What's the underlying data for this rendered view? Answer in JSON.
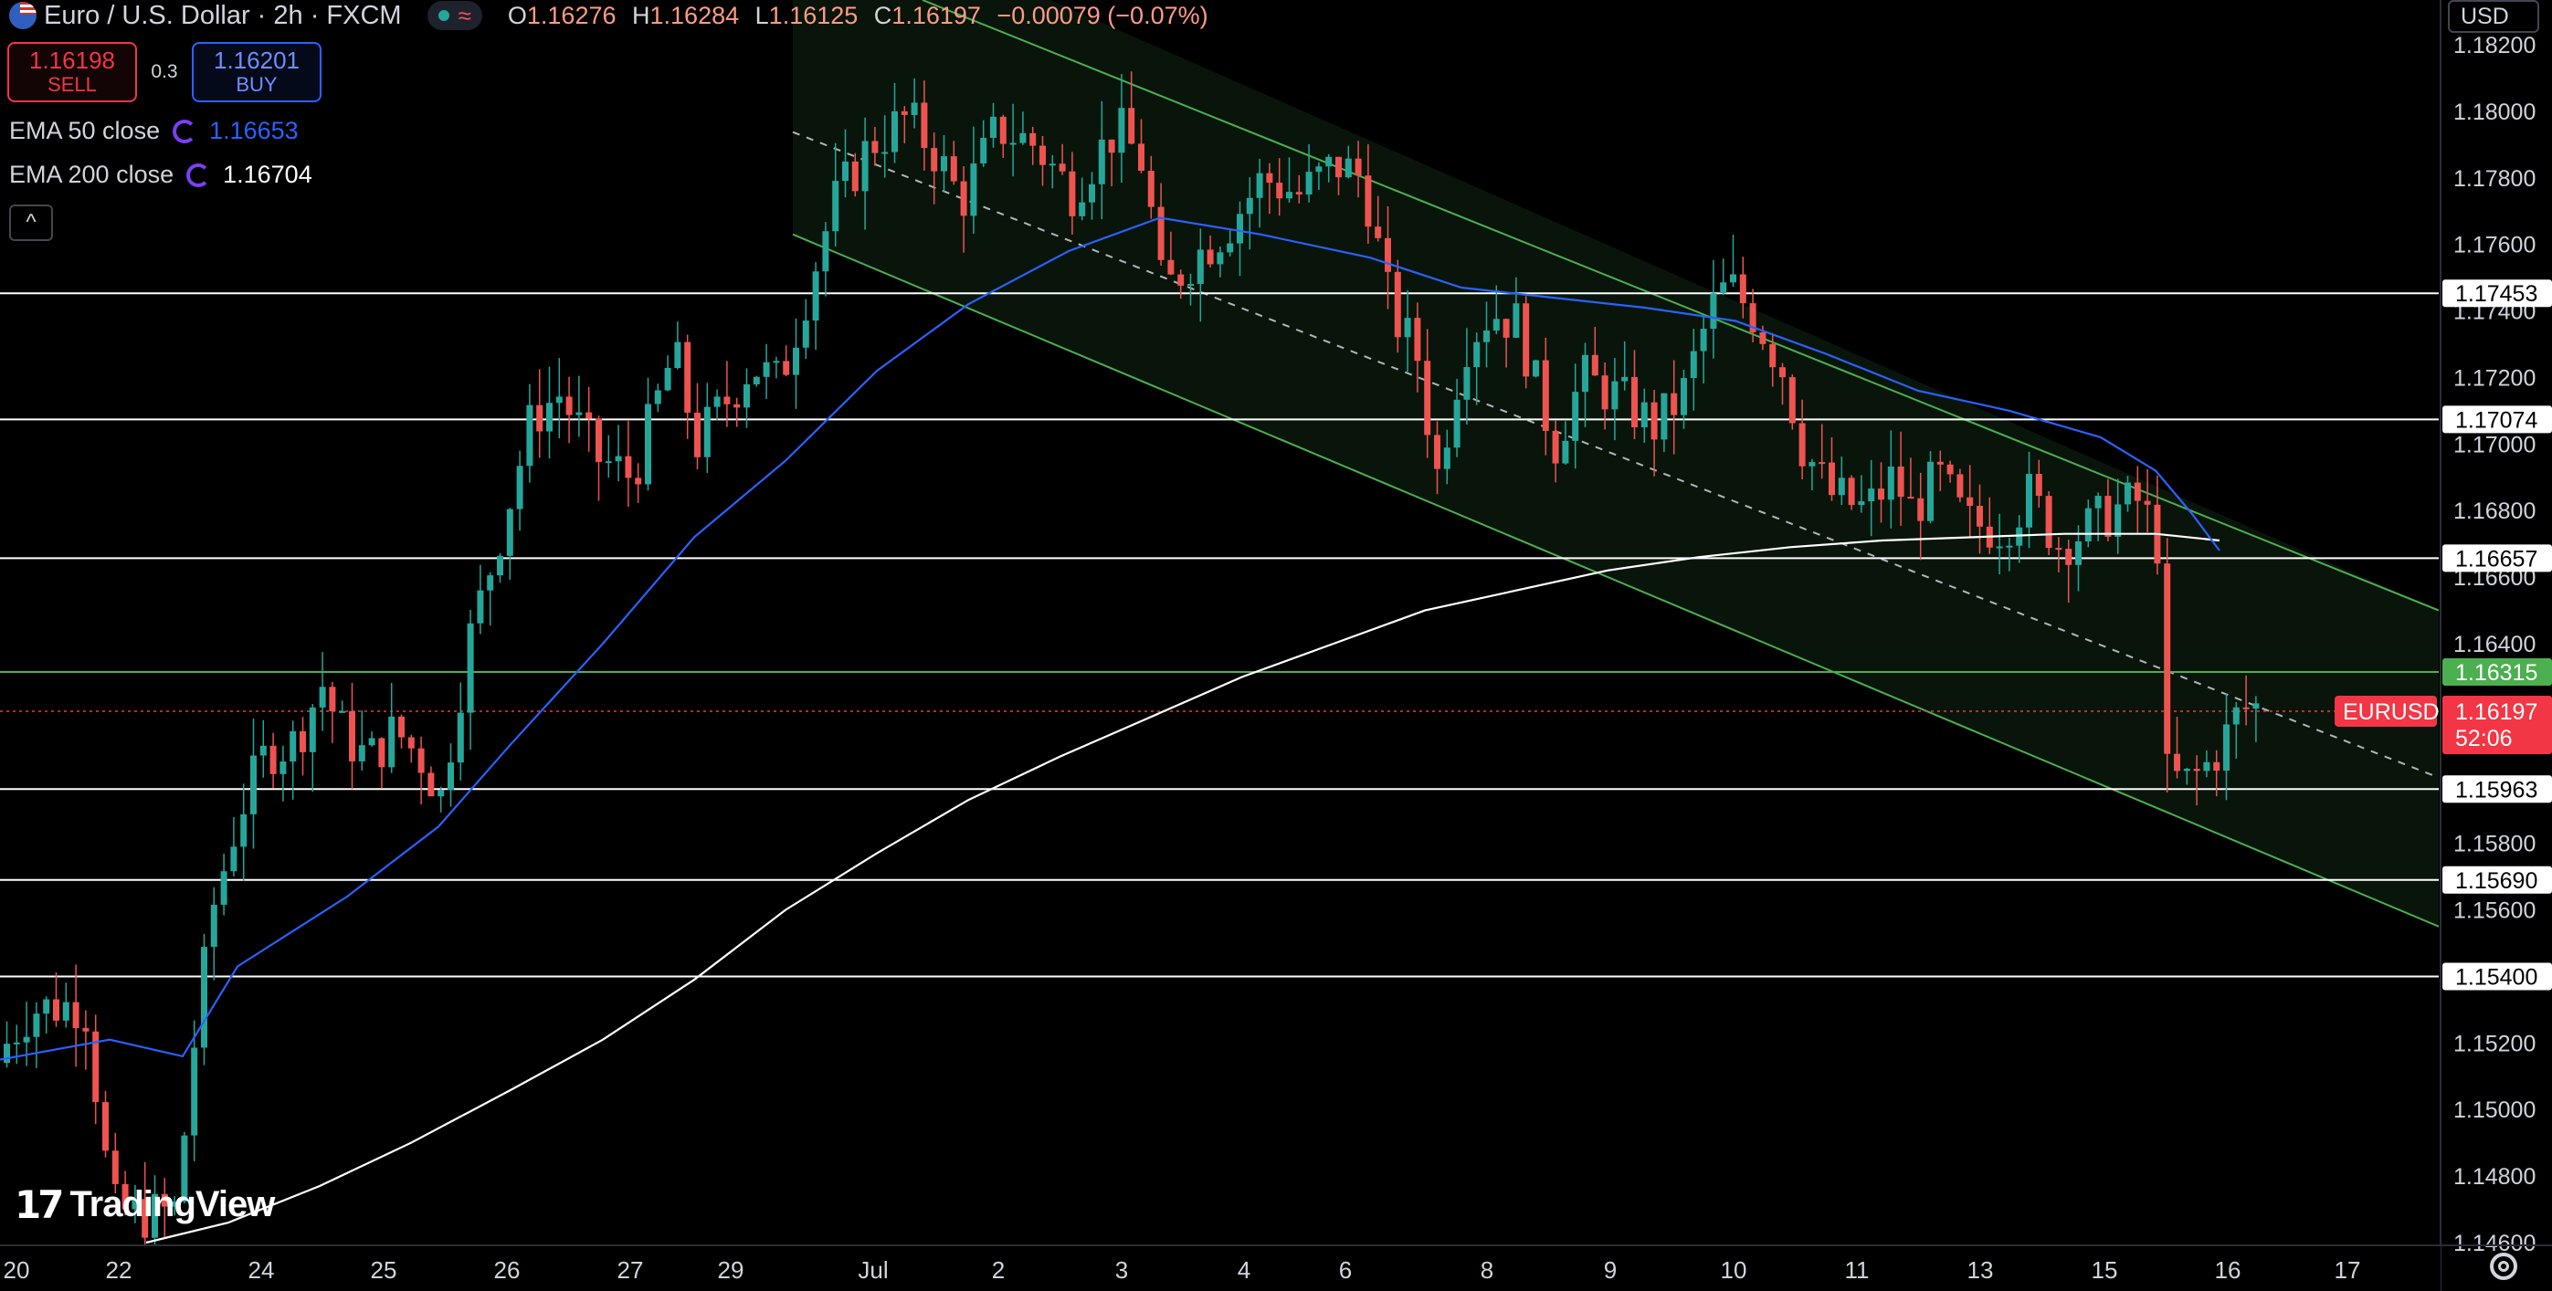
{
  "header": {
    "title": "Euro / U.S. Dollar · 2h · FXCM",
    "open_key": "O",
    "open": "1.16276",
    "high_key": "H",
    "high": "1.16284",
    "low_key": "L",
    "low": "1.16125",
    "close_key": "C",
    "close": "1.16197",
    "change": "−0.00079 (−0.07%)"
  },
  "trade": {
    "sell_price": "1.16198",
    "sell_label": "SELL",
    "spread": "0.3",
    "buy_price": "1.16201",
    "buy_label": "BUY"
  },
  "indicators": {
    "ema50_label": "EMA 50 close",
    "ema50_value": "1.16653",
    "ema200_label": "EMA 200 close",
    "ema200_value": "1.16704"
  },
  "logo_text": "TradingView",
  "currency": "USD",
  "colors": {
    "up": "#26a69a",
    "down": "#ef5350",
    "ema50": "#2962ff",
    "ema200": "#ffffff",
    "channel": "#4caf50",
    "price_tag": "#f23645"
  },
  "chart_data": {
    "type": "candlestick",
    "symbol_tag": "EURUSD",
    "price_tag": "1.16197",
    "countdown": "52:06",
    "y_axis": {
      "range": [
        1.1456,
        1.1832
      ],
      "ticks": [
        "1.18200",
        "1.18000",
        "1.17800",
        "1.17600",
        "1.17400",
        "1.17200",
        "1.17000",
        "1.16800",
        "1.16600",
        "1.16400",
        "1.15800",
        "1.15600",
        "1.15200",
        "1.15000",
        "1.14800",
        "1.14600"
      ]
    },
    "x_axis": {
      "labels": [
        "20",
        "22",
        "24",
        "25",
        "26",
        "27",
        "29",
        "Jul",
        "2",
        "3",
        "4",
        "6",
        "8",
        "9",
        "10",
        "11",
        "13",
        "15",
        "16",
        "17"
      ]
    },
    "horizontal_levels": [
      {
        "value": 1.17453,
        "label": "1.17453",
        "color": "#ffffff"
      },
      {
        "value": 1.17074,
        "label": "1.17074",
        "color": "#ffffff"
      },
      {
        "value": 1.16657,
        "label": "1.16657",
        "color": "#ffffff"
      },
      {
        "value": 1.16315,
        "label": "1.16315",
        "color": "#4caf50"
      },
      {
        "value": 1.15963,
        "label": "1.15963",
        "color": "#ffffff"
      },
      {
        "value": 1.1569,
        "label": "1.15690",
        "color": "#ffffff"
      },
      {
        "value": 1.154,
        "label": "1.15400",
        "color": "#ffffff"
      }
    ],
    "channel": {
      "upper": [
        [
          868,
          1.183
        ],
        [
          2670,
          1.165
        ]
      ],
      "lower": [
        [
          868,
          1.1763
        ],
        [
          2670,
          1.1555
        ]
      ],
      "left_edge": 868
    },
    "ema50_path": [
      [
        0,
        1.1515
      ],
      [
        120,
        1.1521
      ],
      [
        200,
        1.1516
      ],
      [
        260,
        1.1543
      ],
      [
        380,
        1.1564
      ],
      [
        480,
        1.1585
      ],
      [
        560,
        1.161
      ],
      [
        660,
        1.164
      ],
      [
        760,
        1.1672
      ],
      [
        860,
        1.1695
      ],
      [
        960,
        1.1722
      ],
      [
        1060,
        1.1742
      ],
      [
        1170,
        1.1758
      ],
      [
        1270,
        1.1768
      ],
      [
        1380,
        1.1763
      ],
      [
        1500,
        1.1756
      ],
      [
        1600,
        1.1747
      ],
      [
        1700,
        1.1744
      ],
      [
        1800,
        1.1741
      ],
      [
        1900,
        1.1737
      ],
      [
        2000,
        1.1727
      ],
      [
        2100,
        1.1716
      ],
      [
        2200,
        1.171
      ],
      [
        2300,
        1.1702
      ],
      [
        2360,
        1.1692
      ],
      [
        2400,
        1.1679
      ],
      [
        2430,
        1.1668
      ]
    ],
    "ema200_path": [
      [
        160,
        1.146
      ],
      [
        250,
        1.1466
      ],
      [
        350,
        1.1477
      ],
      [
        450,
        1.149
      ],
      [
        560,
        1.1506
      ],
      [
        660,
        1.1521
      ],
      [
        760,
        1.1539
      ],
      [
        860,
        1.156
      ],
      [
        960,
        1.1577
      ],
      [
        1060,
        1.1593
      ],
      [
        1160,
        1.1606
      ],
      [
        1260,
        1.1618
      ],
      [
        1360,
        1.163
      ],
      [
        1460,
        1.164
      ],
      [
        1560,
        1.165
      ],
      [
        1660,
        1.1656
      ],
      [
        1760,
        1.1662
      ],
      [
        1860,
        1.1666
      ],
      [
        1960,
        1.1669
      ],
      [
        2060,
        1.1671
      ],
      [
        2160,
        1.1672
      ],
      [
        2260,
        1.1673
      ],
      [
        2360,
        1.1673
      ],
      [
        2430,
        1.1671
      ]
    ],
    "candle_anchors": [
      [
        0,
        1.1514
      ],
      [
        40,
        1.153
      ],
      [
        100,
        1.1532
      ],
      [
        130,
        1.147
      ],
      [
        170,
        1.1468
      ],
      [
        200,
        1.147
      ],
      [
        220,
        1.152
      ],
      [
        240,
        1.156
      ],
      [
        270,
        1.159
      ],
      [
        300,
        1.1608
      ],
      [
        330,
        1.161
      ],
      [
        360,
        1.1628
      ],
      [
        380,
        1.1614
      ],
      [
        410,
        1.1605
      ],
      [
        440,
        1.1614
      ],
      [
        470,
        1.1605
      ],
      [
        490,
        1.1594
      ],
      [
        520,
        1.164
      ],
      [
        560,
        1.1678
      ],
      [
        590,
        1.1708
      ],
      [
        620,
        1.1715
      ],
      [
        660,
        1.1696
      ],
      [
        700,
        1.169
      ],
      [
        745,
        1.1728
      ],
      [
        770,
        1.17
      ],
      [
        800,
        1.1712
      ],
      [
        830,
        1.1724
      ],
      [
        860,
        1.1718
      ],
      [
        890,
        1.1745
      ],
      [
        920,
        1.1772
      ],
      [
        960,
        1.179
      ],
      [
        1000,
        1.1798
      ],
      [
        1030,
        1.1788
      ],
      [
        1060,
        1.1773
      ],
      [
        1100,
        1.1795
      ],
      [
        1140,
        1.179
      ],
      [
        1180,
        1.1776
      ],
      [
        1230,
        1.1795
      ],
      [
        1260,
        1.1784
      ],
      [
        1280,
        1.1745
      ],
      [
        1310,
        1.1755
      ],
      [
        1350,
        1.1765
      ],
      [
        1390,
        1.178
      ],
      [
        1430,
        1.1775
      ],
      [
        1470,
        1.1784
      ],
      [
        1500,
        1.178
      ],
      [
        1530,
        1.174
      ],
      [
        1560,
        1.1726
      ],
      [
        1580,
        1.169
      ],
      [
        1610,
        1.173
      ],
      [
        1640,
        1.174
      ],
      [
        1670,
        1.1736
      ],
      [
        1690,
        1.1716
      ],
      [
        1710,
        1.17
      ],
      [
        1740,
        1.172
      ],
      [
        1780,
        1.1714
      ],
      [
        1820,
        1.1705
      ],
      [
        1850,
        1.1715
      ],
      [
        1880,
        1.174
      ],
      [
        1900,
        1.1748
      ],
      [
        1930,
        1.1738
      ],
      [
        1960,
        1.1722
      ],
      [
        1980,
        1.17
      ],
      [
        2010,
        1.1685
      ],
      [
        2050,
        1.168
      ],
      [
        2080,
        1.169
      ],
      [
        2100,
        1.168
      ],
      [
        2130,
        1.169
      ],
      [
        2160,
        1.1676
      ],
      [
        2200,
        1.1675
      ],
      [
        2230,
        1.1685
      ],
      [
        2260,
        1.167
      ],
      [
        2290,
        1.1674
      ],
      [
        2320,
        1.168
      ],
      [
        2350,
        1.1683
      ],
      [
        2370,
        1.167
      ],
      [
        2380,
        1.16
      ],
      [
        2400,
        1.1598
      ],
      [
        2420,
        1.1602
      ],
      [
        2440,
        1.161
      ],
      [
        2460,
        1.162
      ],
      [
        2475,
        1.1621
      ]
    ]
  }
}
